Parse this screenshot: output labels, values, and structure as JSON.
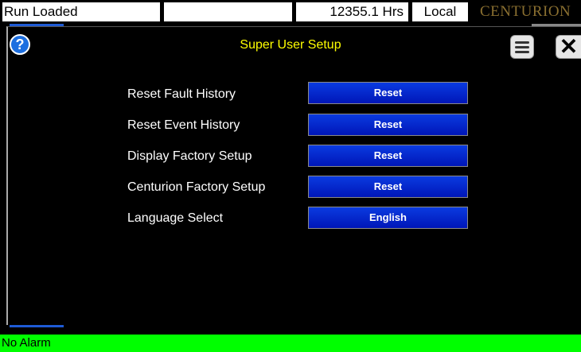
{
  "status_bar": {
    "run_state": "Run Loaded",
    "blank": "",
    "hours": "12355.1 Hrs",
    "mode": "Local",
    "brand": "CENTURION"
  },
  "panel": {
    "title": "Super User Setup",
    "help_icon": "question-icon",
    "menu_icon": "hamburger-icon",
    "close_icon": "close-icon",
    "close_glyph": "✕",
    "help_glyph": "?"
  },
  "rows": [
    {
      "label": "Reset Fault History",
      "button": "Reset"
    },
    {
      "label": "Reset Event History",
      "button": "Reset"
    },
    {
      "label": "Display Factory Setup",
      "button": "Reset"
    },
    {
      "label": "Centurion Factory Setup",
      "button": "Reset"
    },
    {
      "label": "Language Select",
      "button": "English"
    }
  ],
  "alarm": {
    "text": "No Alarm",
    "color": "#00ff00"
  },
  "colors": {
    "accent": "#ffff00",
    "button_blue": "#0022cc"
  }
}
